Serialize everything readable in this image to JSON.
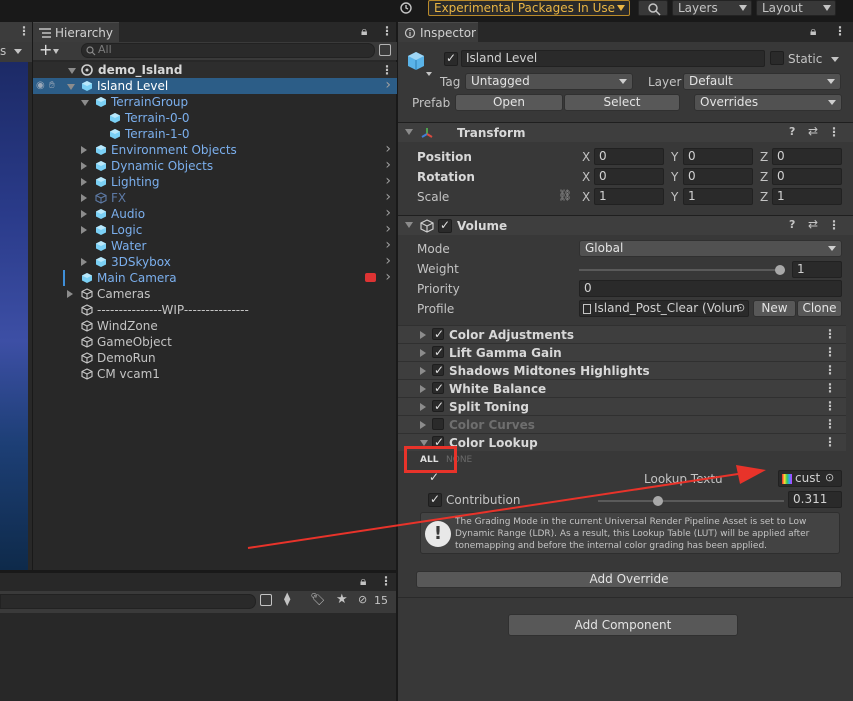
{
  "toolbar": {
    "experimental_label": "Experimental Packages In Use",
    "layers_label": "Layers",
    "layout_label": "Layout"
  },
  "scene_tab": {
    "label": "s"
  },
  "hierarchy": {
    "tab_label": "Hierarchy",
    "search_placeholder": "All",
    "add_label": "+",
    "scene_name": "demo_Island",
    "items": [
      {
        "label": "Island Level"
      },
      {
        "label": "TerrainGroup"
      },
      {
        "label": "Terrain-0-0"
      },
      {
        "label": "Terrain-1-0"
      },
      {
        "label": "Environment Objects"
      },
      {
        "label": "Dynamic Objects"
      },
      {
        "label": "Lighting"
      },
      {
        "label": "FX"
      },
      {
        "label": "Audio"
      },
      {
        "label": "Logic"
      },
      {
        "label": "Water"
      },
      {
        "label": "3DSkybox"
      },
      {
        "label": "Main Camera"
      },
      {
        "label": "Cameras"
      },
      {
        "label": "---------------WIP---------------"
      },
      {
        "label": "WindZone"
      },
      {
        "label": "GameObject"
      },
      {
        "label": "DemoRun"
      },
      {
        "label": "CM vcam1"
      }
    ]
  },
  "bottom_panel": {
    "hidden_count": "15"
  },
  "inspector": {
    "tab_label": "Inspector",
    "object_name": "Island Level",
    "static_label": "Static",
    "tag_label": "Tag",
    "tag_value": "Untagged",
    "layer_label": "Layer",
    "layer_value": "Default",
    "prefab_label": "Prefab",
    "open_label": "Open",
    "select_label": "Select",
    "overrides_label": "Overrides",
    "transform": {
      "title": "Transform",
      "position_label": "Position",
      "rotation_label": "Rotation",
      "scale_label": "Scale",
      "x": "X",
      "y": "Y",
      "z": "Z",
      "position": [
        "0",
        "0",
        "0"
      ],
      "rotation": [
        "0",
        "0",
        "0"
      ],
      "scale": [
        "1",
        "1",
        "1"
      ]
    },
    "volume": {
      "title": "Volume",
      "mode_label": "Mode",
      "mode_value": "Global",
      "weight_label": "Weight",
      "weight_value": "1",
      "weight_fraction": 1.0,
      "priority_label": "Priority",
      "priority_value": "0",
      "profile_label": "Profile",
      "profile_value": "Island_Post_Clear (Volun",
      "new_label": "New",
      "clone_label": "Clone"
    },
    "overrides": [
      {
        "label": "Color Adjustments",
        "enabled": true
      },
      {
        "label": "Lift Gamma Gain",
        "enabled": true
      },
      {
        "label": "Shadows Midtones Highlights",
        "enabled": true
      },
      {
        "label": "White Balance",
        "enabled": true
      },
      {
        "label": "Split Toning",
        "enabled": true
      },
      {
        "label": "Color Curves",
        "enabled": false
      },
      {
        "label": "Color Lookup",
        "enabled": true
      }
    ],
    "color_lookup": {
      "all_label": "ALL",
      "none_label": "NONE",
      "lookup_texture_label": "Lookup Textu",
      "lookup_texture_value": "cust",
      "contribution_label": "Contribution",
      "contribution_value": "0.311",
      "contribution_fraction": 0.311,
      "info_text": "The Grading Mode in the current Universal Render Pipeline Asset is set to Low Dynamic Range (LDR). As a result, this Lookup Table (LUT) will be applied after tonemapping and before the internal color grading has been applied."
    },
    "add_override_label": "Add Override",
    "add_component_label": "Add Component"
  },
  "colors": {
    "annotation_red": "#e8332a",
    "selection_blue": "#2c5d87",
    "warning_orange": "#e9b544"
  }
}
